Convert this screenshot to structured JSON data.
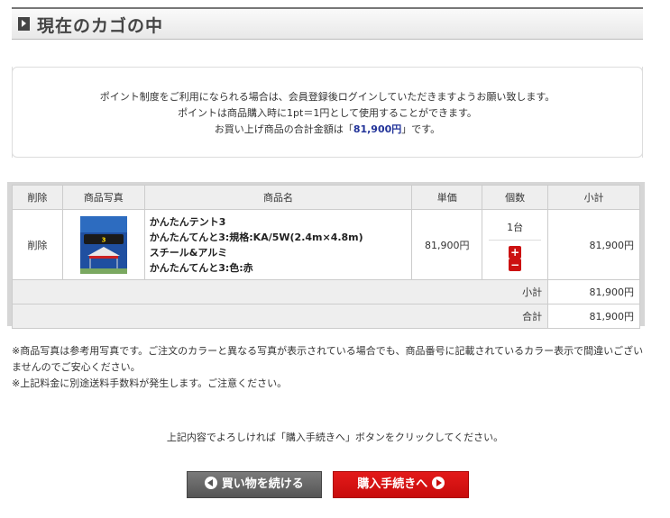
{
  "page_title": "現在のカゴの中",
  "info": {
    "line1": "ポイント制度をご利用になられる場合は、会員登録後ログインしていただきますようお願い致します。",
    "line2": "ポイントは商品購入時に1pt＝1円として使用することができます。",
    "line3_before": "お買い上げ商品の合計金額は「",
    "total": "81,900円",
    "line3_after": "」です。"
  },
  "table": {
    "headers": [
      "削除",
      "商品写真",
      "商品名",
      "単価",
      "個数",
      "小計"
    ],
    "row": {
      "delete": "削除",
      "photo_label": "かんたんテント3",
      "name_lines": [
        "かんたんテント3",
        "かんたんてんと3:規格:KA/5W(2.4m×4.8m)",
        "スチール&アルミ",
        "かんたんてんと3:色:赤"
      ],
      "price": "81,900円",
      "qty": "1台",
      "plus": "+",
      "minus": "−",
      "subtotal": "81,900円"
    },
    "subtotal_label": "小計",
    "subtotal_value": "81,900円",
    "total_label": "合計",
    "total_value": "81,900円"
  },
  "notes": {
    "line1": "※商品写真は参考用写真です。ご注文のカラーと異なる写真が表示されている場合でも、商品番号に記載されているカラー表示で間違いございませんのでご安心ください。",
    "line2": "※上記料金に別途送料手数料が発生します。ご注意ください。"
  },
  "confirm": "上記内容でよろしければ「購入手続きへ」ボタンをクリックしてください。",
  "buttons": {
    "back": "買い物を続ける",
    "next": "購入手続きへ"
  },
  "colors": {
    "accent_red": "#cc1111",
    "total_blue": "#223399"
  }
}
